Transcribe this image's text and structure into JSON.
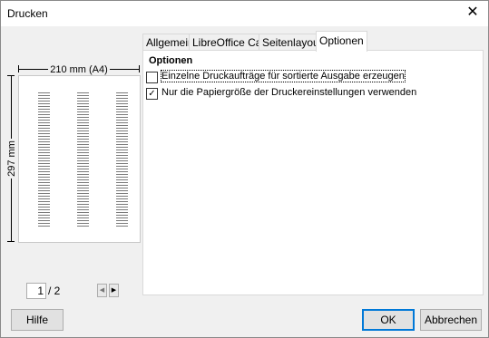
{
  "dialog": {
    "title": "Drucken"
  },
  "preview": {
    "width_label": "210 mm (A4)",
    "height_label": "297 mm",
    "current_page": "1",
    "total_pages": "/ 2",
    "prev_icon": "triangle-left-icon",
    "next_icon": "triangle-right-icon"
  },
  "tabs": [
    "Allgemein",
    "LibreOffice Calc",
    "Seitenlayout",
    "Optionen"
  ],
  "active_tab": "Optionen",
  "options": {
    "section_title": "Optionen",
    "items": [
      {
        "label": "Einzelne Druckaufträge für sortierte Ausgabe erzeugen",
        "checked": false
      },
      {
        "label": "Nur die Papiergröße der Druckereinstellungen verwenden",
        "checked": true
      }
    ]
  },
  "buttons": {
    "help": "Hilfe",
    "ok": "OK",
    "cancel": "Abbrechen"
  },
  "icons": {
    "close": "close-icon",
    "checkmark": "checkmark-icon"
  }
}
